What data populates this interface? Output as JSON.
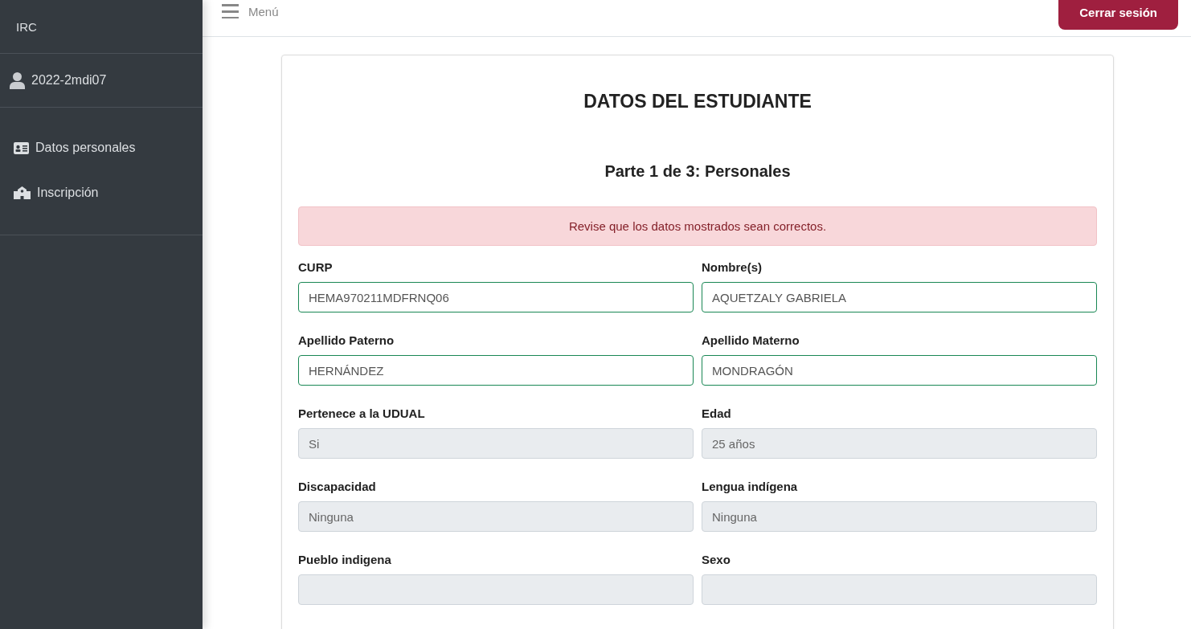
{
  "sidebar": {
    "brand": "IRC",
    "user": "2022-2mdi07",
    "items": [
      {
        "kind": "id-card",
        "label": "Datos personales"
      },
      {
        "kind": "school",
        "label": "Inscripción"
      }
    ]
  },
  "topbar": {
    "menu_label": "Menú",
    "logout": "Cerrar sesión"
  },
  "card": {
    "title": "DATOS DEL ESTUDIANTE",
    "subtitle": "Parte 1 de 3: Personales",
    "alert": "Revise que los datos mostrados sean correctos.",
    "fields": [
      {
        "label": "CURP",
        "value": "HEMA970211MDFRNQ06",
        "disabled": false
      },
      {
        "label": "Nombre(s)",
        "value": "AQUETZALY GABRIELA",
        "disabled": false
      },
      {
        "label": "Apellido Paterno",
        "value": "HERNÁNDEZ",
        "disabled": false
      },
      {
        "label": "Apellido Materno",
        "value": "MONDRAGÓN",
        "disabled": false
      },
      {
        "label": "Pertenece a la UDUAL",
        "value": "Si",
        "disabled": true
      },
      {
        "label": "Edad",
        "value": "25 años",
        "disabled": true
      },
      {
        "label": "Discapacidad",
        "value": "Ninguna",
        "disabled": true
      },
      {
        "label": "Lengua indígena",
        "value": "Ninguna",
        "disabled": true
      },
      {
        "label": "Pueblo indigena",
        "disabled": true
      },
      {
        "label": "Sexo",
        "disabled": true
      }
    ]
  }
}
